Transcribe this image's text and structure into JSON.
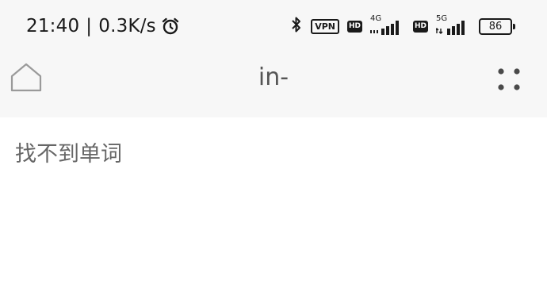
{
  "status_bar": {
    "time": "21:40",
    "separator": "|",
    "net_speed": "0.3K/s",
    "vpn": "VPN",
    "hd1": "HD",
    "net1": "4G",
    "hd2": "HD",
    "net2": "5G",
    "battery": "86"
  },
  "toolbar": {
    "title": "in-"
  },
  "content": {
    "message": "找不到单词"
  }
}
